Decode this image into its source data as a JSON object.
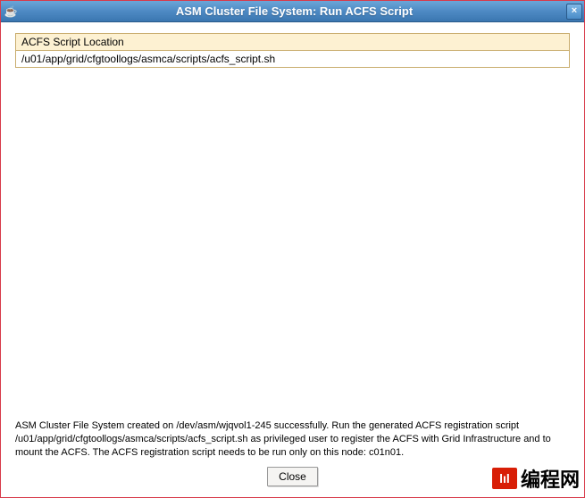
{
  "titlebar": {
    "title": "ASM Cluster File System: Run ACFS Script",
    "java_icon": "☕",
    "close_glyph": "×"
  },
  "table": {
    "header": "ACFS Script Location",
    "row": "/u01/app/grid/cfgtoollogs/asmca/scripts/acfs_script.sh"
  },
  "status": "ASM Cluster File System created on /dev/asm/wjqvol1-245 successfully. Run the generated ACFS registration script /u01/app/grid/cfgtoollogs/asmca/scripts/acfs_script.sh as privileged user to register the ACFS with Grid Infrastructure and to mount the ACFS. The ACFS registration script needs to be run only on this node: c01n01.",
  "buttons": {
    "close": "Close"
  },
  "watermark": {
    "logo": "lıl",
    "text": "编程网"
  }
}
